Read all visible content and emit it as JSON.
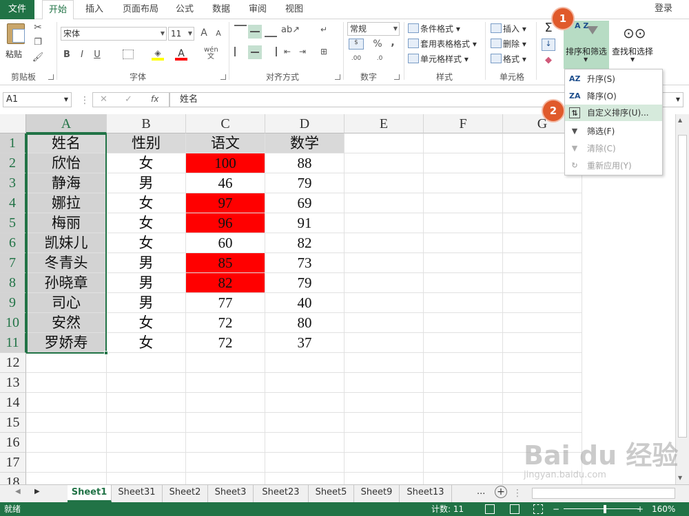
{
  "tabs": {
    "file": "文件",
    "items": [
      "开始",
      "插入",
      "页面布局",
      "公式",
      "数据",
      "审阅",
      "视图"
    ],
    "active": "开始",
    "login": "登录"
  },
  "ribbon": {
    "clipboard": {
      "label": "剪贴板",
      "paste": "粘贴"
    },
    "font": {
      "label": "字体",
      "name": "宋体",
      "size": "11",
      "bold": "B",
      "italic": "I",
      "underline": "U",
      "grow": "A",
      "shrink": "A",
      "font_color": "A",
      "wen": "wén",
      "wen_sub": "文"
    },
    "alignment": {
      "label": "对齐方式"
    },
    "number": {
      "label": "数字",
      "format": "常规",
      "percent": "%",
      "comma": ",",
      "inc_dec": ".00",
      "dec_dec": ".0"
    },
    "styles": {
      "label": "样式",
      "conditional": "条件格式",
      "table": "套用表格格式",
      "cell": "单元格样式"
    },
    "cells": {
      "label": "单元格",
      "insert": "插入",
      "delete": "删除",
      "format": "格式"
    },
    "editing": {
      "sum": "Σ",
      "sort_filter": "排序和筛选",
      "find_select": "查找和选择",
      "az": "A Z"
    }
  },
  "formula_bar": {
    "name_box": "A1",
    "fx": "fx",
    "content": "姓名",
    "cancel": "✕",
    "enter": "✓"
  },
  "grid": {
    "columns": [
      "A",
      "B",
      "C",
      "D",
      "E",
      "F",
      "G"
    ],
    "rows": [
      "1",
      "2",
      "3",
      "4",
      "5",
      "6",
      "7",
      "8",
      "9",
      "10",
      "11",
      "12",
      "13",
      "14",
      "15",
      "16",
      "17",
      "18"
    ],
    "headers": [
      "姓名",
      "性别",
      "语文",
      "数学"
    ],
    "data": [
      [
        "欣怡",
        "女",
        "100",
        "88"
      ],
      [
        "静海",
        "男",
        "46",
        "79"
      ],
      [
        "娜拉",
        "女",
        "97",
        "69"
      ],
      [
        "梅丽",
        "女",
        "96",
        "91"
      ],
      [
        "凯妹儿",
        "女",
        "60",
        "82"
      ],
      [
        "冬青头",
        "男",
        "85",
        "73"
      ],
      [
        "孙晓章",
        "男",
        "82",
        "79"
      ],
      [
        "司心",
        "男",
        "77",
        "40"
      ],
      [
        "安然",
        "女",
        "72",
        "80"
      ],
      [
        "罗娇寿",
        "女",
        "72",
        "37"
      ]
    ],
    "highlight_color": "#ff0000",
    "highlighted_rows": [
      0,
      2,
      3,
      5,
      6
    ]
  },
  "sort_menu": {
    "items": [
      {
        "label": "升序(S)",
        "icon": "AZ"
      },
      {
        "label": "降序(O)",
        "icon": "ZA"
      },
      {
        "label": "自定义排序(U)...",
        "icon": "⇅"
      },
      {
        "label": "筛选(F)",
        "icon": "▼"
      },
      {
        "label": "清除(C)",
        "icon": "▼"
      },
      {
        "label": "重新应用(Y)",
        "icon": "↻"
      }
    ]
  },
  "badges": {
    "one": "1",
    "two": "2"
  },
  "sheets": {
    "tabs": [
      "Sheet1",
      "Sheet31",
      "Sheet2",
      "Sheet3",
      "Sheet23",
      "Sheet5",
      "Sheet9",
      "Sheet13"
    ],
    "active": "Sheet1",
    "more": "...",
    "add": "+"
  },
  "status": {
    "ready": "就绪",
    "count": "计数: 11",
    "zoom": "160%"
  },
  "watermark": {
    "brand": "Bai du 经验",
    "url": "jingyan.baidu.com"
  },
  "colors": {
    "accent": "#217346",
    "badge": "#e05a2b"
  }
}
